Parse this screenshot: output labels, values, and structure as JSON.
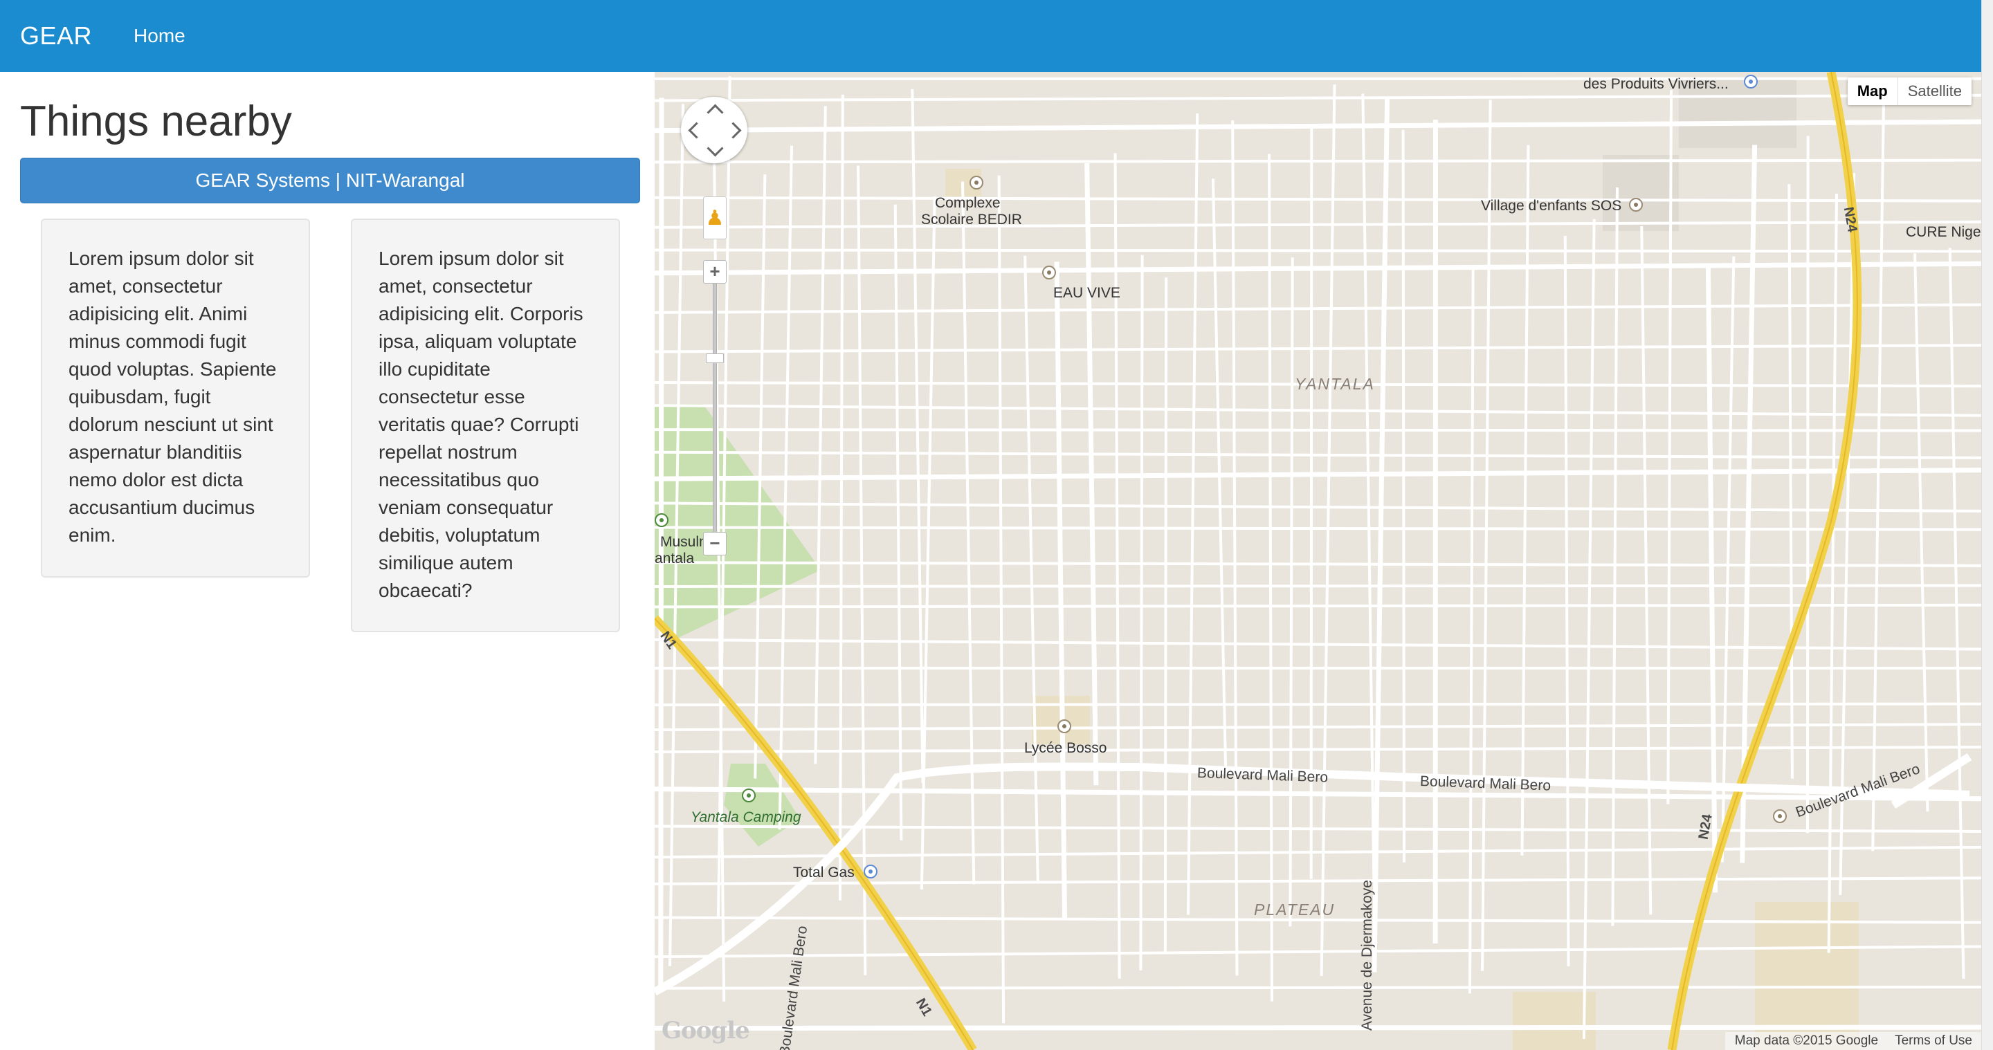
{
  "navbar": {
    "brand": "GEAR",
    "home": "Home",
    "color": "#1a8ccf"
  },
  "sidebar": {
    "title": "Things nearby",
    "button_label": "GEAR Systems | NIT-Warangal",
    "cards": [
      {
        "text": "Lorem ipsum dolor sit amet, consectetur adipisicing elit. Animi minus commodi fugit quod voluptas. Sapiente quibusdam, fugit dolorum nesciunt ut sint aspernatur blanditiis nemo dolor est dicta accusantium ducimus enim."
      },
      {
        "text": "Lorem ipsum dolor sit amet, consectetur adipisicing elit. Corporis ipsa, aliquam voluptate illo cupiditate consectetur esse veritatis quae? Corrupti repellat nostrum necessitatibus quo veniam consequatur debitis, voluptatum similique autem obcaecati?"
      }
    ]
  },
  "map": {
    "type_controls": {
      "map": "Map",
      "satellite": "Satellite"
    },
    "attribution": {
      "data": "Map data ©2015 Google",
      "terms": "Terms of Use"
    },
    "logo": "Google",
    "labels": {
      "complexe": "Complexe",
      "scolaire": "Scolaire BEDIR",
      "eau_vive": "EAU VIVE",
      "village": "Village d'enfants SOS",
      "cure": "CURE Nige",
      "produits": "des Produits Vivriers...",
      "yantala": "YANTALA",
      "musulm": "Musulm",
      "antala": "antala",
      "lycee": "Lycée Bosso",
      "camping": "Yantala Camping",
      "total": "Total Gas",
      "plateau": "PLATEAU",
      "blvd1": "Boulevard Mali Bero",
      "blvd2": "Boulevard Mali Bero",
      "blvd3": "Boulevard Mali Bero",
      "blvd4": "Boulevard Mali Bero",
      "djermakoye": "Avenue de Djermakoye",
      "n1a": "N1",
      "n1b": "N1",
      "n24a": "N24",
      "n24b": "N24"
    }
  }
}
